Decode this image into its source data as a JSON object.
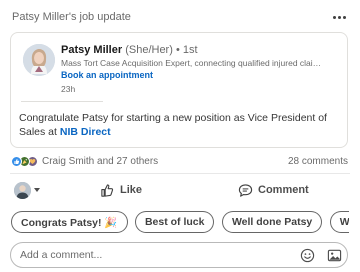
{
  "header": {
    "title": "Patsy Miller's job update"
  },
  "post": {
    "author": {
      "name": "Patsy Miller",
      "pronouns": "(She/Her)",
      "degree": "• 1st",
      "headline": "Mass Tort Case Acquisition Expert, connecting qualified injured claima...",
      "appointment_label": "Book an appointment",
      "time": "23h"
    },
    "body": {
      "text": "Congratulate Patsy for starting a new position as Vice President of Sales at",
      "company": "NIB Direct"
    }
  },
  "social": {
    "reaction_summary": "Craig Smith and 27 others",
    "comments_count": "28 comments",
    "reaction_icons": [
      "like-icon",
      "celebrate-icon",
      "support-icon"
    ]
  },
  "actions": {
    "like_label": "Like",
    "comment_label": "Comment"
  },
  "chips": [
    "Congrats Patsy! 🎉",
    "Best of luck",
    "Well done Patsy",
    "What an ac"
  ],
  "composer": {
    "placeholder": "Add a comment..."
  },
  "colors": {
    "link": "#0a66c2",
    "like": "#378fe9",
    "celebrate": "#44712e",
    "support": "#715e86"
  }
}
